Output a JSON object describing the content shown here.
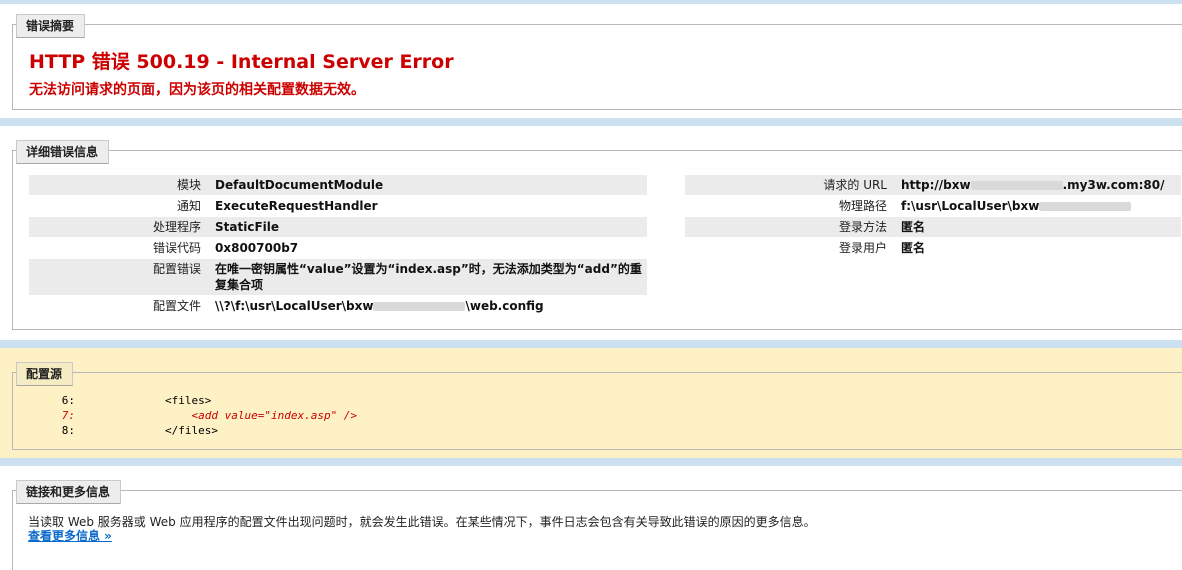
{
  "summary": {
    "legend": "错误摘要",
    "title": "HTTP 错误 500.19 - Internal Server Error",
    "subtitle": "无法访问请求的页面，因为该页的相关配置数据无效。"
  },
  "details": {
    "legend": "详细错误信息",
    "left": [
      {
        "label": "模块",
        "value": "DefaultDocumentModule"
      },
      {
        "label": "通知",
        "value": "ExecuteRequestHandler"
      },
      {
        "label": "处理程序",
        "value": "StaticFile"
      },
      {
        "label": "错误代码",
        "value": "0x800700b7"
      },
      {
        "label": "配置错误",
        "value": "在唯一密钥属性“value”设置为“index.asp”时，无法添加类型为“add”的重复集合项"
      },
      {
        "label": "配置文件",
        "value_prefix": "\\\\?\\f:\\usr\\LocalUser\\bxw",
        "value_suffix": "\\web.config"
      }
    ],
    "right": [
      {
        "label": "请求的 URL",
        "value_prefix": "http://bxw",
        "value_suffix": ".my3w.com:80/"
      },
      {
        "label": "物理路径",
        "value_prefix": "f:\\usr\\LocalUser\\bxw",
        "value_suffix": ""
      },
      {
        "label": "登录方法",
        "value": "匿名"
      },
      {
        "label": "登录用户",
        "value": "匿名"
      }
    ]
  },
  "config_source": {
    "legend": "配置源",
    "lines": [
      {
        "num": "6:",
        "text": "<files>"
      },
      {
        "num": "7:",
        "text": "    <add value=\"index.asp\" />"
      },
      {
        "num": "8:",
        "text": "</files>"
      }
    ]
  },
  "links": {
    "legend": "链接和更多信息",
    "text": "当读取 Web 服务器或 Web 应用程序的配置文件出现问题时，就会发生此错误。在某些情况下，事件日志会包含有关导致此错误的原因的更多信息。",
    "more_link": "查看更多信息 »"
  }
}
